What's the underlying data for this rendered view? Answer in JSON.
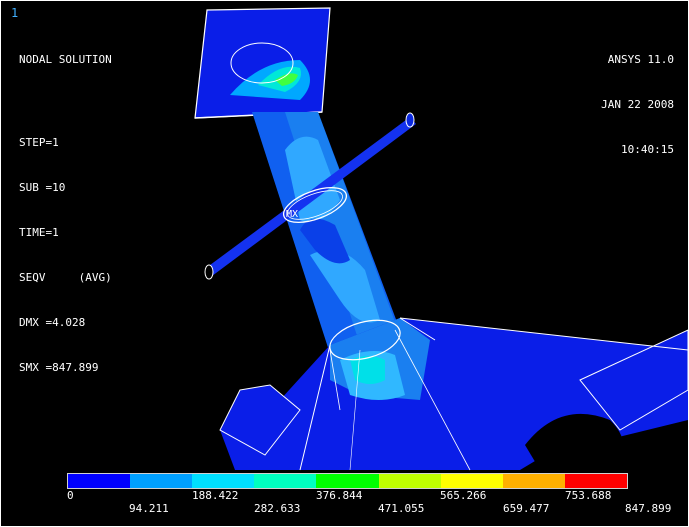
{
  "window_number": "1",
  "result": {
    "title": "NODAL SOLUTION",
    "step": "STEP=1",
    "sub": "SUB =10",
    "time": "TIME=1",
    "quantity": "SEQV     (AVG)",
    "dmx": "DMX =4.028",
    "smx": "SMX =847.899"
  },
  "header": {
    "program": "ANSYS 11.0",
    "date": "JAN 22 2008",
    "time": "10:40:15"
  },
  "markers": {
    "mx": "MX"
  },
  "legend": {
    "colors": [
      "#0000ff",
      "#00a0ff",
      "#00e0ff",
      "#00ffc0",
      "#00ff00",
      "#c0ff00",
      "#ffff00",
      "#ffb000",
      "#ff0000"
    ],
    "labels_top": [
      "0",
      "188.422",
      "376.844",
      "565.266",
      "753.688"
    ],
    "labels_bottom": [
      "94.211",
      "282.633",
      "471.055",
      "659.477",
      "847.899"
    ]
  }
}
